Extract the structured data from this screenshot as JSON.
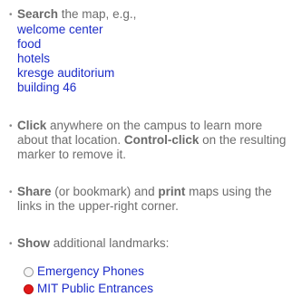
{
  "help": {
    "search": {
      "strong": "Search",
      "rest": " the map, e.g.,",
      "examples": [
        "welcome center",
        "food",
        "hotels",
        "kresge auditorium",
        "building 46"
      ]
    },
    "click": {
      "strong": "Click",
      "rest1": " anywhere on the campus to learn more about that location. ",
      "strong2": "Control-click",
      "rest2": " on the resulting marker to remove it."
    },
    "share": {
      "strong": "Share",
      "rest1": " (or bookmark) and ",
      "strong2": "print",
      "rest2": " maps using the links in the upper-right corner."
    },
    "show": {
      "strong": "Show",
      "rest": " additional landmarks:"
    },
    "landmarks": [
      {
        "label": "Emergency Phones",
        "selected": false
      },
      {
        "label": "MIT Public Entrances",
        "selected": true
      }
    ],
    "bullet_glyph": "•",
    "colors": {
      "link": "#1c2cc8",
      "text": "#6d6d6d",
      "marker_on": "#e21818"
    }
  }
}
